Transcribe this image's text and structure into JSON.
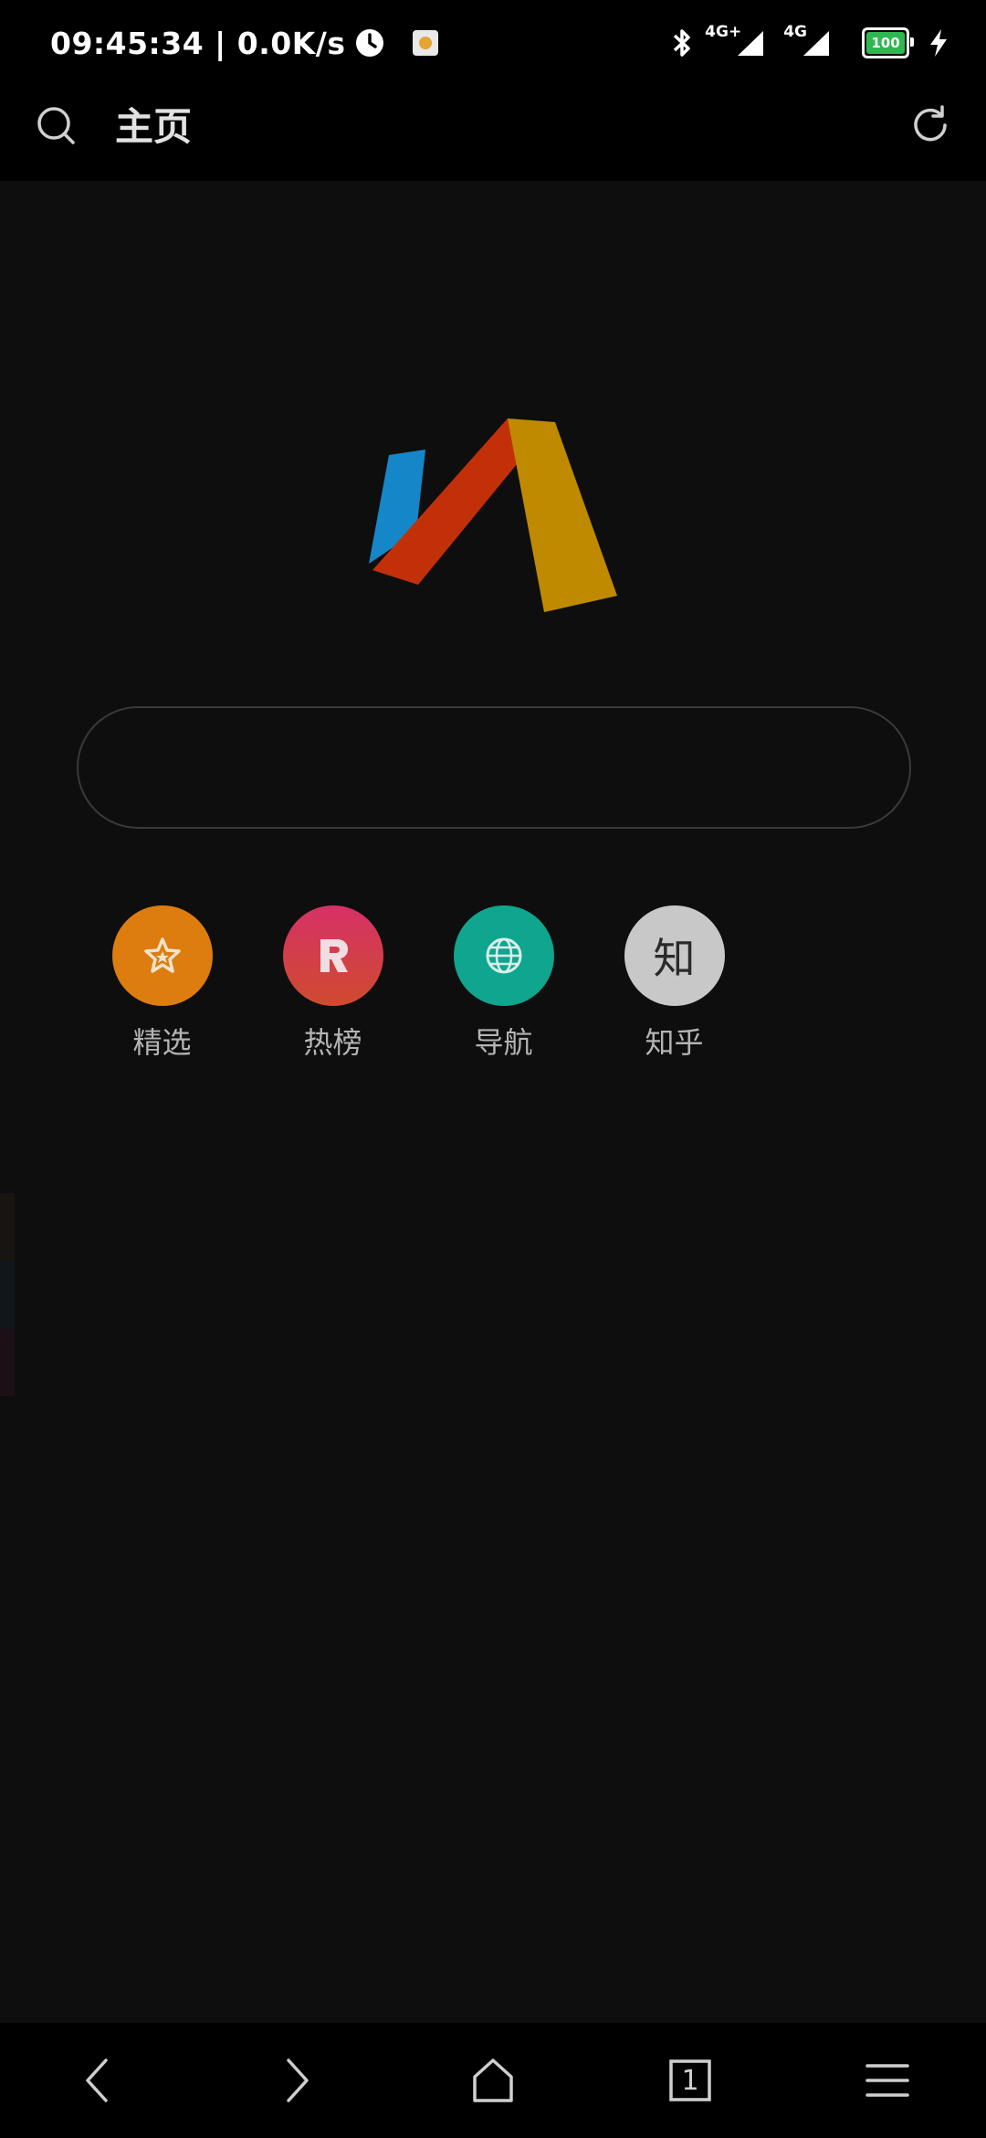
{
  "status_bar": {
    "time": "09:45:34",
    "separator": "|",
    "net_speed": "0.0K/s",
    "network_labels": [
      "4G+",
      "4G"
    ],
    "battery_level": "100",
    "battery_color": "#2fb84f"
  },
  "header": {
    "title": "主页",
    "icons": [
      "search-icon",
      "refresh-icon"
    ]
  },
  "search": {
    "placeholder": "",
    "value": ""
  },
  "shortcuts": [
    {
      "label": "精选",
      "icon": "star-icon",
      "color": "#dd7d10"
    },
    {
      "label": "热榜",
      "icon": "r-icon",
      "color": "#d63a56"
    },
    {
      "label": "导航",
      "icon": "globe-icon",
      "color": "#0fa58e"
    },
    {
      "label": "知乎",
      "icon": "zhi-icon",
      "glyph": "知",
      "color": "#c8c8c8"
    }
  ],
  "bottom_nav": {
    "items": [
      "back-icon",
      "forward-icon",
      "home-icon",
      "tabs-icon",
      "menu-icon"
    ],
    "tab_count": "1"
  },
  "colors": {
    "background": "#0e0e0e",
    "bars": "#000000",
    "logo_blue": "#1587c8",
    "logo_red": "#c2300a",
    "logo_gold": "#c08a00"
  }
}
